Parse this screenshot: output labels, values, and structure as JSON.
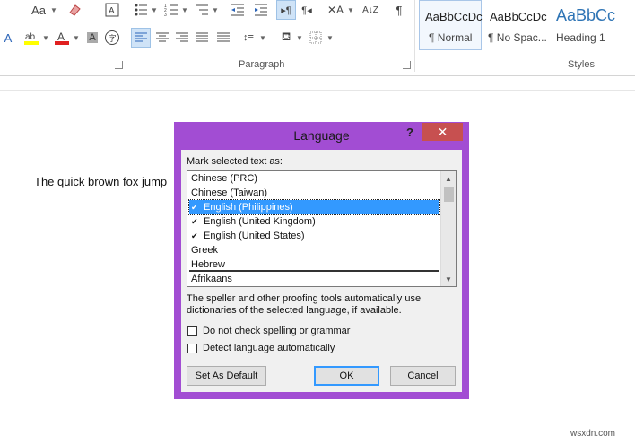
{
  "ribbon": {
    "font_group": {
      "change_case": "Aa",
      "highlight_icon": "text-highlight-icon",
      "font_color_icon": "font-color-icon"
    },
    "paragraph_group": {
      "label": "Paragraph"
    },
    "styles_group": {
      "label": "Styles",
      "styles": [
        {
          "sample": "AaBbCcDc",
          "name": "¶ Normal"
        },
        {
          "sample": "AaBbCcDc",
          "name": "¶ No Spac..."
        },
        {
          "sample": "AaBbCc",
          "name": "Heading 1"
        }
      ]
    },
    "accent_color": "#cfe3f7"
  },
  "document": {
    "text": "The quick brown fox jump"
  },
  "dialog": {
    "title": "Language",
    "help": "?",
    "close": "✕",
    "frame_color": "#a24dd3",
    "mark_label": "Mark selected text as:",
    "languages": [
      {
        "name": "Chinese (PRC)",
        "spell": false,
        "selected": false
      },
      {
        "name": "Chinese (Taiwan)",
        "spell": false,
        "selected": false
      },
      {
        "name": "English (Philippines)",
        "spell": true,
        "selected": true
      },
      {
        "name": "English (United Kingdom)",
        "spell": true,
        "selected": false
      },
      {
        "name": "English (United States)",
        "spell": true,
        "selected": false
      },
      {
        "name": "Greek",
        "spell": false,
        "selected": false
      },
      {
        "name": "Hebrew",
        "spell": false,
        "selected": false
      }
    ],
    "default_language": "Afrikaans",
    "info_text_line1": "The speller and other proofing tools automatically use",
    "info_text_line2": "dictionaries of the selected language, if available.",
    "checkbox_no_spell": "Do not check spelling or grammar",
    "checkbox_detect": "Detect language automatically",
    "btn_set_default": "Set As Default",
    "btn_ok": "OK",
    "btn_cancel": "Cancel"
  },
  "watermark": "wsxdn.com"
}
